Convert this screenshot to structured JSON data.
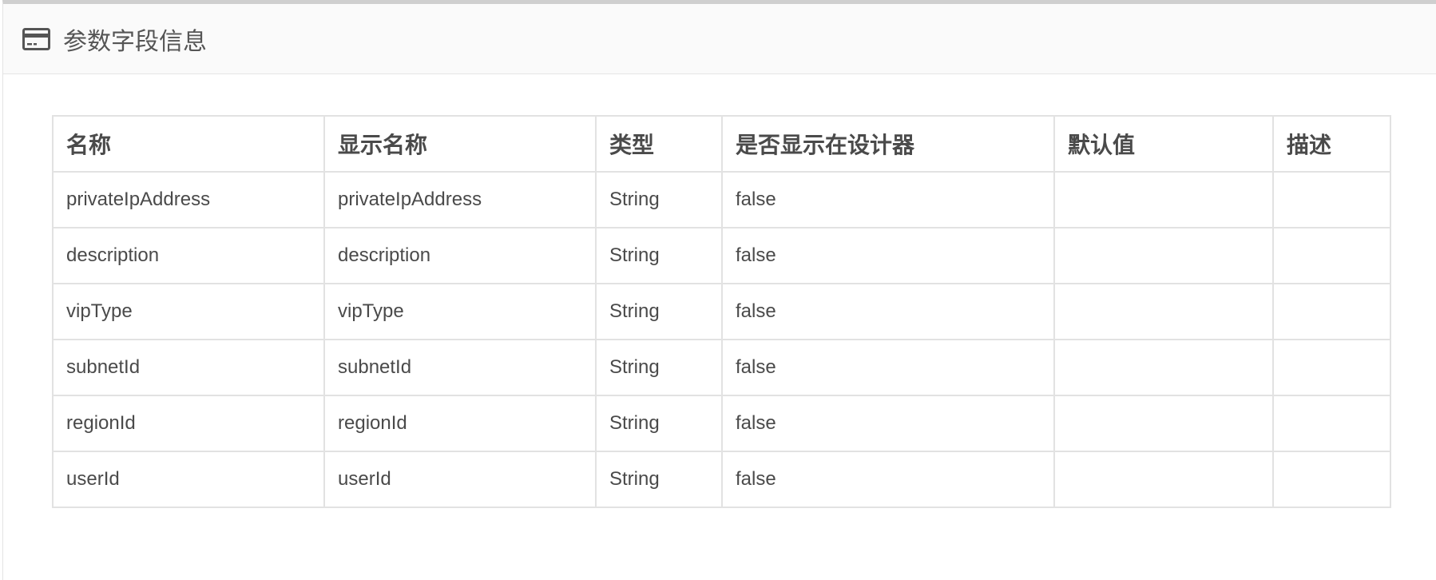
{
  "panel": {
    "title": "参数字段信息",
    "icon": "credit-card-icon"
  },
  "table": {
    "headers": [
      "名称",
      "显示名称",
      "类型",
      "是否显示在设计器",
      "默认值",
      "描述"
    ],
    "rows": [
      [
        "privateIpAddress",
        "privateIpAddress",
        "String",
        "false",
        "",
        ""
      ],
      [
        "description",
        "description",
        "String",
        "false",
        "",
        ""
      ],
      [
        "vipType",
        "vipType",
        "String",
        "false",
        "",
        ""
      ],
      [
        "subnetId",
        "subnetId",
        "String",
        "false",
        "",
        ""
      ],
      [
        "regionId",
        "regionId",
        "String",
        "false",
        "",
        ""
      ],
      [
        "userId",
        "userId",
        "String",
        "false",
        "",
        ""
      ]
    ]
  },
  "colors": {
    "border": "#e2e2e2",
    "header_bg": "#fafafa",
    "text": "#4a4a4a"
  }
}
